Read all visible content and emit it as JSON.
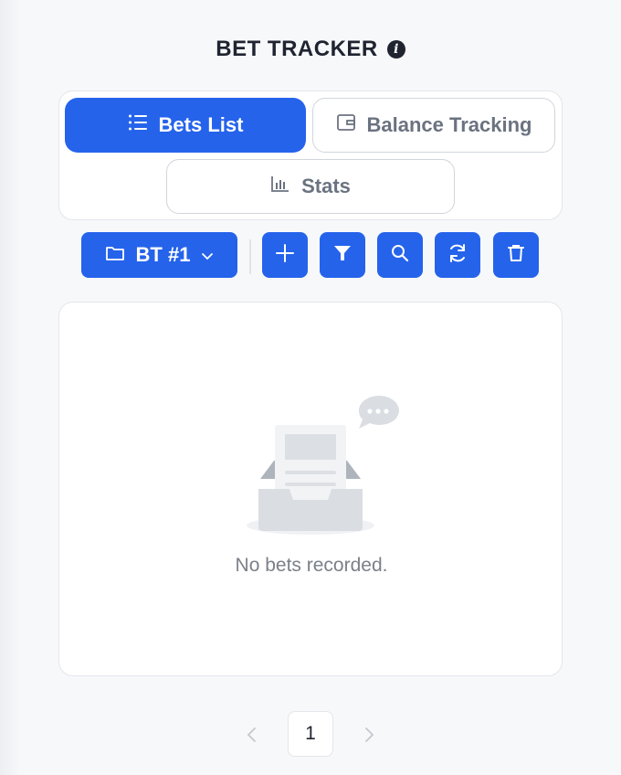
{
  "header": {
    "title": "BET TRACKER",
    "info_icon": "info-circle-icon",
    "info_glyph": "i"
  },
  "tabs": [
    {
      "label": "Bets List",
      "icon": "list-icon",
      "active": true
    },
    {
      "label": "Balance Tracking",
      "icon": "wallet-icon",
      "active": false
    },
    {
      "label": "Stats",
      "icon": "bar-chart-icon",
      "active": false
    }
  ],
  "toolbar": {
    "tracker_select": {
      "value": "BT #1",
      "icon": "folder-icon"
    },
    "buttons": [
      "add-icon",
      "filter-icon",
      "search-icon",
      "refresh-icon",
      "delete-icon"
    ]
  },
  "list": {
    "empty_text": "No bets recorded.",
    "empty_icon": "empty-inbox-icon"
  },
  "pagination": {
    "current_page": "1"
  },
  "colors": {
    "accent": "#2563eb",
    "text_dark": "#1f2430",
    "text_muted": "#6b7280",
    "border": "#e3e6ea"
  }
}
